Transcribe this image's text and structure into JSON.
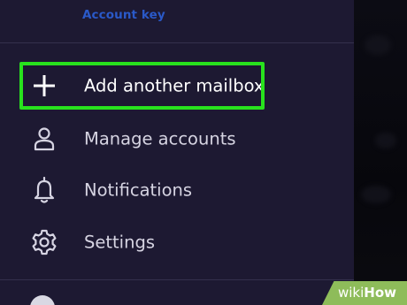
{
  "header": {
    "account_key_label": "Account key"
  },
  "menu": {
    "items": [
      {
        "id": "add-mailbox",
        "label": "Add another mailbox",
        "icon": "plus-icon"
      },
      {
        "id": "manage-accounts",
        "label": "Manage accounts",
        "icon": "person-icon"
      },
      {
        "id": "notifications",
        "label": "Notifications",
        "icon": "bell-icon"
      },
      {
        "id": "settings",
        "label": "Settings",
        "icon": "gear-icon"
      }
    ]
  },
  "highlight": {
    "color": "#28e21d",
    "target": "add-mailbox"
  },
  "colors": {
    "drawer_bg": "#1d1932",
    "account_key": "#2a59c8",
    "label": "#d6d4e2"
  },
  "watermark": {
    "wiki": "wiki",
    "how": "How"
  }
}
